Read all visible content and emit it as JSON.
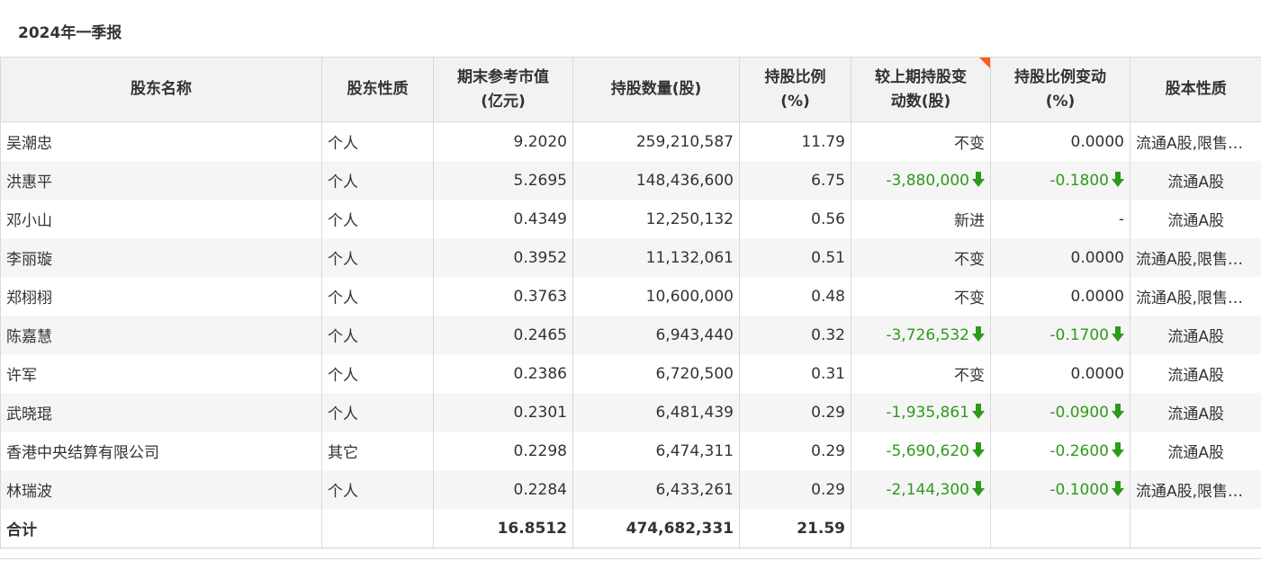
{
  "section_title": "2024年一季报",
  "colors": {
    "decrease": "#2d9b1a",
    "header_bg": "#f2f2f2",
    "accent": "#ff5a1f"
  },
  "columns": [
    {
      "line1": "股东名称",
      "line2": ""
    },
    {
      "line1": "股东性质",
      "line2": ""
    },
    {
      "line1": "期末参考市值",
      "line2": "(亿元)"
    },
    {
      "line1": "持股数量(股)",
      "line2": ""
    },
    {
      "line1": "持股比例",
      "line2": "(%)"
    },
    {
      "line1": "较上期持股变",
      "line2": "动数(股)"
    },
    {
      "line1": "持股比例变动",
      "line2": "(%)"
    },
    {
      "line1": "股本性质",
      "line2": ""
    }
  ],
  "rows": [
    {
      "name": "吴潮忠",
      "type": "个人",
      "value": "9.2020",
      "shares": "259,210,587",
      "ratio": "11.79",
      "change": "不变",
      "change_down": false,
      "ratio_change": "0.0000",
      "ratio_down": false,
      "nature": "流通A股,限售流通A股"
    },
    {
      "name": "洪惠平",
      "type": "个人",
      "value": "5.2695",
      "shares": "148,436,600",
      "ratio": "6.75",
      "change": "-3,880,000",
      "change_down": true,
      "ratio_change": "-0.1800",
      "ratio_down": true,
      "nature": "流通A股"
    },
    {
      "name": "邓小山",
      "type": "个人",
      "value": "0.4349",
      "shares": "12,250,132",
      "ratio": "0.56",
      "change": "新进",
      "change_down": false,
      "ratio_change": "-",
      "ratio_down": false,
      "nature": "流通A股"
    },
    {
      "name": "李丽璇",
      "type": "个人",
      "value": "0.3952",
      "shares": "11,132,061",
      "ratio": "0.51",
      "change": "不变",
      "change_down": false,
      "ratio_change": "0.0000",
      "ratio_down": false,
      "nature": "流通A股,限售流通A股"
    },
    {
      "name": "郑栩栩",
      "type": "个人",
      "value": "0.3763",
      "shares": "10,600,000",
      "ratio": "0.48",
      "change": "不变",
      "change_down": false,
      "ratio_change": "0.0000",
      "ratio_down": false,
      "nature": "流通A股,限售流通A股"
    },
    {
      "name": "陈嘉慧",
      "type": "个人",
      "value": "0.2465",
      "shares": "6,943,440",
      "ratio": "0.32",
      "change": "-3,726,532",
      "change_down": true,
      "ratio_change": "-0.1700",
      "ratio_down": true,
      "nature": "流通A股"
    },
    {
      "name": "许军",
      "type": "个人",
      "value": "0.2386",
      "shares": "6,720,500",
      "ratio": "0.31",
      "change": "不变",
      "change_down": false,
      "ratio_change": "0.0000",
      "ratio_down": false,
      "nature": "流通A股"
    },
    {
      "name": "武晓琨",
      "type": "个人",
      "value": "0.2301",
      "shares": "6,481,439",
      "ratio": "0.29",
      "change": "-1,935,861",
      "change_down": true,
      "ratio_change": "-0.0900",
      "ratio_down": true,
      "nature": "流通A股"
    },
    {
      "name": "香港中央结算有限公司",
      "type": "其它",
      "value": "0.2298",
      "shares": "6,474,311",
      "ratio": "0.29",
      "change": "-5,690,620",
      "change_down": true,
      "ratio_change": "-0.2600",
      "ratio_down": true,
      "nature": "流通A股"
    },
    {
      "name": "林瑞波",
      "type": "个人",
      "value": "0.2284",
      "shares": "6,433,261",
      "ratio": "0.29",
      "change": "-2,144,300",
      "change_down": true,
      "ratio_change": "-0.1000",
      "ratio_down": true,
      "nature": "流通A股,限售流通A股"
    }
  ],
  "total": {
    "label": "合计",
    "value": "16.8512",
    "shares": "474,682,331",
    "ratio": "21.59"
  }
}
